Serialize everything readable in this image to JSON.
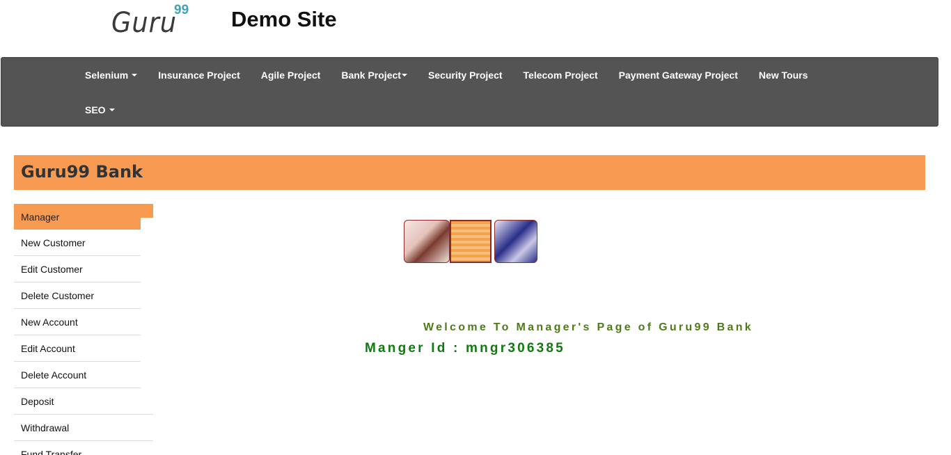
{
  "header": {
    "logo_text": "Guru",
    "logo_superscript": "99",
    "site_title": "Demo Site"
  },
  "navbar": {
    "row1": [
      {
        "label": "Selenium",
        "dropdown": true
      },
      {
        "label": "Insurance Project",
        "dropdown": false
      },
      {
        "label": "Agile Project",
        "dropdown": false
      },
      {
        "label": "Bank Project",
        "dropdown": true
      },
      {
        "label": "Security Project",
        "dropdown": false
      },
      {
        "label": "Telecom Project",
        "dropdown": false
      },
      {
        "label": "Payment Gateway Project",
        "dropdown": false
      },
      {
        "label": "New Tours",
        "dropdown": false
      }
    ],
    "row2": [
      {
        "label": "SEO",
        "dropdown": true
      }
    ]
  },
  "bank": {
    "title": "Guru99 Bank"
  },
  "sidebar": {
    "items": [
      {
        "label": "Manager",
        "active": true
      },
      {
        "label": "New Customer"
      },
      {
        "label": "Edit Customer"
      },
      {
        "label": "Delete Customer"
      },
      {
        "label": "New Account"
      },
      {
        "label": "Edit Account"
      },
      {
        "label": "Delete Account"
      },
      {
        "label": "Deposit"
      },
      {
        "label": "Withdrawal"
      },
      {
        "label": "Fund Transfer"
      }
    ]
  },
  "main": {
    "welcome": "Welcome To Manager's Page of Guru99 Bank",
    "manager_id": "Manger Id : mngr306385"
  },
  "colors": {
    "navbar_bg": "#545454",
    "accent_orange": "#f79b52",
    "welcome_green": "#4f7a1a",
    "manager_id_green": "#0f7a0f"
  }
}
